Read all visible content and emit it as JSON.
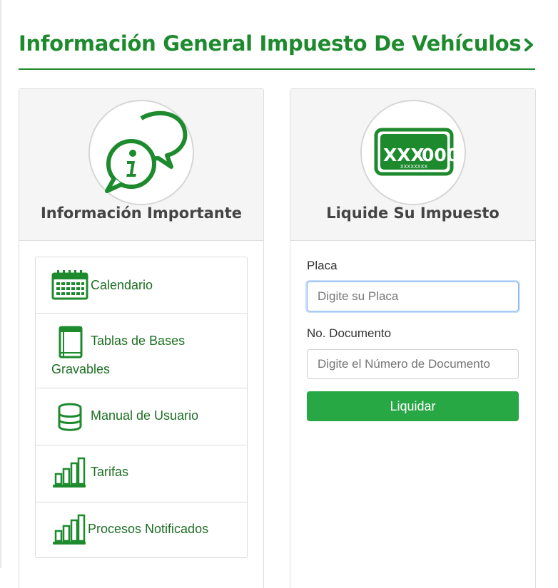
{
  "page": {
    "title": "Información General Impuesto De Vehículos"
  },
  "colors": {
    "brand_green": "#1e8a2e",
    "button_green": "#28a745",
    "link_green": "#1d6f24"
  },
  "info_panel": {
    "icon": "info-chat-icon",
    "title": "Información Importante",
    "links": [
      {
        "icon": "calendar-icon",
        "label_line1": "Calendario",
        "label_line2": ""
      },
      {
        "icon": "book-icon",
        "label_line1": "Tablas de Bases",
        "label_line2": "Gravables"
      },
      {
        "icon": "database-icon",
        "label_line1": "Manual de Usuario",
        "label_line2": ""
      },
      {
        "icon": "bar-chart-icon",
        "label_line1": "Tarifas",
        "label_line2": ""
      },
      {
        "icon": "bar-chart-icon",
        "label_line1": "Procesos Notificados",
        "label_line2": ""
      }
    ]
  },
  "liquidate_panel": {
    "icon": "license-plate-icon",
    "plate_icon_text": {
      "letters": "XXX",
      "numbers": "000",
      "small": "XXXXXXXX"
    },
    "title": "Liquide Su Impuesto",
    "placa_label": "Placa",
    "placa_placeholder": "Digite su Placa",
    "placa_value": "",
    "documento_label": "No. Documento",
    "documento_placeholder": "Digite el Número de Documento",
    "documento_value": "",
    "submit_label": "Liquidar"
  }
}
